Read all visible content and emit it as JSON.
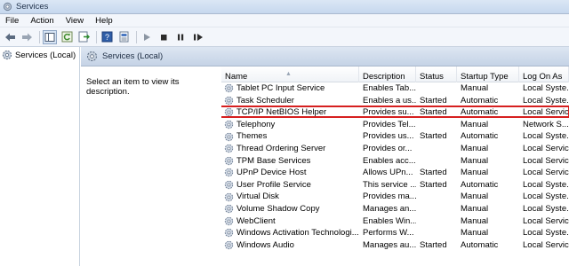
{
  "window": {
    "title": "Services"
  },
  "menu": [
    "File",
    "Action",
    "View",
    "Help"
  ],
  "toolbar_icons": [
    "back-icon",
    "forward-icon",
    "show-hide-tree-icon",
    "refresh-icon",
    "export-icon",
    "help-icon",
    "properties-icon",
    "start-icon",
    "stop-icon",
    "pause-icon",
    "restart-icon"
  ],
  "tree": {
    "root_label": "Services (Local)"
  },
  "pane": {
    "header": "Services (Local)",
    "description": "Select an item to view its description."
  },
  "columns": {
    "name": "Name",
    "description": "Description",
    "status": "Status",
    "startup": "Startup Type",
    "logon": "Log On As"
  },
  "services": [
    {
      "name": "Tablet PC Input Service",
      "description": "Enables Tab...",
      "status": "",
      "startup": "Manual",
      "logon": "Local Syste..."
    },
    {
      "name": "Task Scheduler",
      "description": "Enables a us...",
      "status": "Started",
      "startup": "Automatic",
      "logon": "Local Syste..."
    },
    {
      "name": "TCP/IP NetBIOS Helper",
      "description": "Provides su...",
      "status": "Started",
      "startup": "Automatic",
      "logon": "Local Service",
      "highlighted": true
    },
    {
      "name": "Telephony",
      "description": "Provides Tel...",
      "status": "",
      "startup": "Manual",
      "logon": "Network S..."
    },
    {
      "name": "Themes",
      "description": "Provides us...",
      "status": "Started",
      "startup": "Automatic",
      "logon": "Local Syste..."
    },
    {
      "name": "Thread Ordering Server",
      "description": "Provides or...",
      "status": "",
      "startup": "Manual",
      "logon": "Local Service"
    },
    {
      "name": "TPM Base Services",
      "description": "Enables acc...",
      "status": "",
      "startup": "Manual",
      "logon": "Local Service"
    },
    {
      "name": "UPnP Device Host",
      "description": "Allows UPn...",
      "status": "Started",
      "startup": "Manual",
      "logon": "Local Service"
    },
    {
      "name": "User Profile Service",
      "description": "This service ...",
      "status": "Started",
      "startup": "Automatic",
      "logon": "Local Syste..."
    },
    {
      "name": "Virtual Disk",
      "description": "Provides ma...",
      "status": "",
      "startup": "Manual",
      "logon": "Local Syste..."
    },
    {
      "name": "Volume Shadow Copy",
      "description": "Manages an...",
      "status": "",
      "startup": "Manual",
      "logon": "Local Syste..."
    },
    {
      "name": "WebClient",
      "description": "Enables Win...",
      "status": "",
      "startup": "Manual",
      "logon": "Local Service"
    },
    {
      "name": "Windows Activation Technologi...",
      "description": "Performs W...",
      "status": "",
      "startup": "Manual",
      "logon": "Local Syste..."
    },
    {
      "name": "Windows Audio",
      "description": "Manages au...",
      "status": "Started",
      "startup": "Automatic",
      "logon": "Local Service"
    }
  ],
  "colors": {
    "highlight_border": "#d61f1f",
    "header_gradient_top": "#dde6f2"
  }
}
